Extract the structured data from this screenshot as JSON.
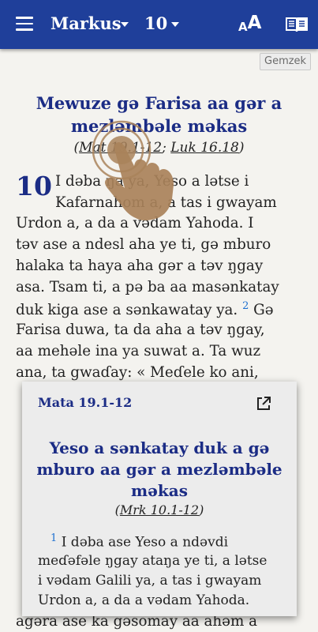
{
  "appbar": {
    "book": "Markus",
    "chapter": "10",
    "icons": [
      "menu-icon",
      "font-size-icon",
      "book-open-icon"
    ]
  },
  "gemzek_label": "Gemzek",
  "section": {
    "title_line1": "Mewuze gə Farisa aa gər a",
    "title_line2": "mezləmbəle məkas",
    "ref_open": "(",
    "ref1": "Mat 19.1-12",
    "ref_sep": "; ",
    "ref2": "Luk 16.18",
    "ref_close": ")"
  },
  "chapter_number": "10",
  "body": {
    "line1": "I dəba ŋa ya, Yeso a lətse i",
    "line2": "Kafarnahom a, a tas i gwayam",
    "line3": "Urdon a, a da a vədam Yahoda. I",
    "line4": "təv ase a ndesl aha ye ti, gə mburo",
    "line5": "halaka ta haya aha gər a təv ŋgay",
    "line6": "asa. Tsam ti, a pə ba aa masənkatay",
    "line7": "duk kiga ase a sənkawatay ya.",
    "verse2": "2",
    "line8a": "Gə",
    "line9": "Farisa duwa, ta da aha a təv ŋgay,",
    "line10": "aa mehəle ina ya suwat a. Ta wuz",
    "line11": "ana, ta gwaɗay: « Meɗele ko ani,",
    "line12": "agəra ase ka gəsomay aa ahəm a"
  },
  "popup": {
    "ref": "Mata 19.1-12",
    "title_line1": "Yeso a sənkatay duk a gə",
    "title_line2": "mburo aa gər a mezləmbəle",
    "title_line3": "məkas",
    "refs_open": "(",
    "refs_link": "Mrk 10.1-12",
    "refs_close": ")",
    "verse": "1",
    "line1": "I dəba ase Yeso a ndəvdi",
    "line2": "meɗəfəle ŋgay ataŋa ye ti, a lətse",
    "line3": "i vədam Galili ya, a tas i gwayam",
    "line4": "Urdon a, a da a vədam Yahoda."
  },
  "colors": {
    "appbar": "#1f3f9a",
    "title": "#1b2c85",
    "verse_number": "#1b6fd0",
    "page": "#f4f3ef"
  }
}
